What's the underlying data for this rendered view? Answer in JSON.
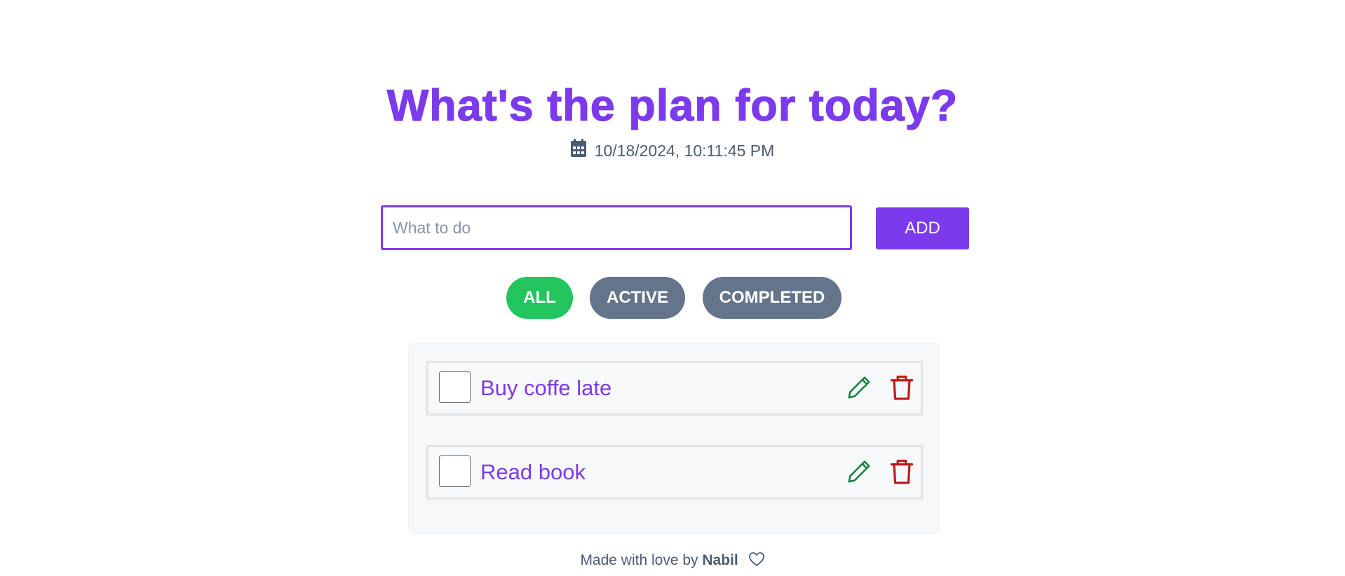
{
  "header": {
    "title": "What's the plan for today?",
    "datetime": "10/18/2024, 10:11:45 PM",
    "calendar_icon": "calendar-icon"
  },
  "form": {
    "input_value": "",
    "input_placeholder": "What to do",
    "add_label": "ADD"
  },
  "filters": {
    "all": "ALL",
    "active": "ACTIVE",
    "completed": "COMPLETED",
    "selected": "ALL"
  },
  "todos": [
    {
      "text": "Buy coffe late",
      "completed": false
    },
    {
      "text": "Read book",
      "completed": false
    }
  ],
  "footer": {
    "prefix": "Made with love by",
    "author": "Nabil",
    "icon": "heart-icon"
  },
  "colors": {
    "accent": "#7c3aed",
    "filter_selected": "#22c55e",
    "filter_default": "#64748b",
    "edit": "#15803d",
    "delete": "#b91c1c"
  }
}
